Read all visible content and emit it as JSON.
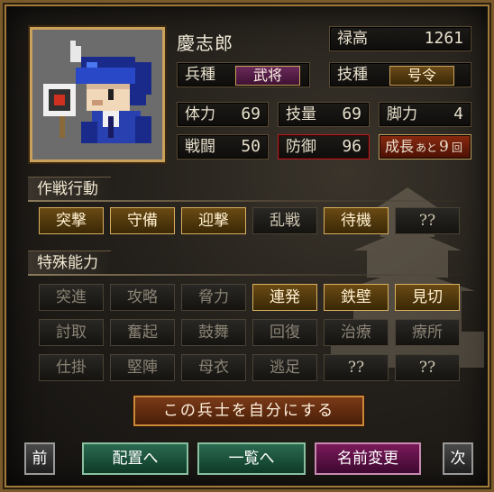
{
  "character": {
    "name": "慶志郎",
    "stipend_label": "禄高",
    "stipend_value": "1261",
    "troop_type_label": "兵種",
    "troop_type_value": "武将",
    "skill_type_label": "技種",
    "skill_type_value": "号令"
  },
  "stats": {
    "stamina_label": "体力",
    "stamina_value": "69",
    "skill_label": "技量",
    "skill_value": "69",
    "speed_label": "脚力",
    "speed_value": "4",
    "combat_label": "戦闘",
    "combat_value": "50",
    "defense_label": "防御",
    "defense_value": "96",
    "growth_label": "成長",
    "growth_prefix": "あと",
    "growth_value": "9",
    "growth_suffix": "回"
  },
  "tactics": {
    "title": "作戦行動",
    "buttons": [
      {
        "label": "突撃",
        "selected": true
      },
      {
        "label": "守備",
        "selected": true
      },
      {
        "label": "迎撃",
        "selected": true
      },
      {
        "label": "乱戦",
        "selected": false
      },
      {
        "label": "待機",
        "selected": true
      },
      {
        "label": "??",
        "selected": false
      }
    ]
  },
  "abilities": {
    "title": "特殊能力",
    "rows": [
      [
        {
          "label": "突進",
          "active": false
        },
        {
          "label": "攻略",
          "active": false
        },
        {
          "label": "脅力",
          "active": false
        },
        {
          "label": "連発",
          "active": true
        },
        {
          "label": "鉄壁",
          "active": true
        },
        {
          "label": "見切",
          "active": true
        }
      ],
      [
        {
          "label": "討取",
          "active": false
        },
        {
          "label": "奮起",
          "active": false
        },
        {
          "label": "鼓舞",
          "active": false
        },
        {
          "label": "回復",
          "active": false
        },
        {
          "label": "治療",
          "active": false
        },
        {
          "label": "療所",
          "active": false
        }
      ],
      [
        {
          "label": "仕掛",
          "active": false
        },
        {
          "label": "堅陣",
          "active": false
        },
        {
          "label": "母衣",
          "active": false
        },
        {
          "label": "逃足",
          "active": false
        },
        {
          "label": "??",
          "active": false
        },
        {
          "label": "??",
          "active": false
        }
      ]
    ]
  },
  "actions": {
    "make_own": "この兵士を自分にする",
    "prev": "前",
    "deploy": "配置へ",
    "list": "一覧へ",
    "rename": "名前変更",
    "next": "次"
  },
  "colors": {
    "gold_border": "#c9a15a",
    "selected_bg": "#6a4a14",
    "red_frame": "#b02020"
  }
}
